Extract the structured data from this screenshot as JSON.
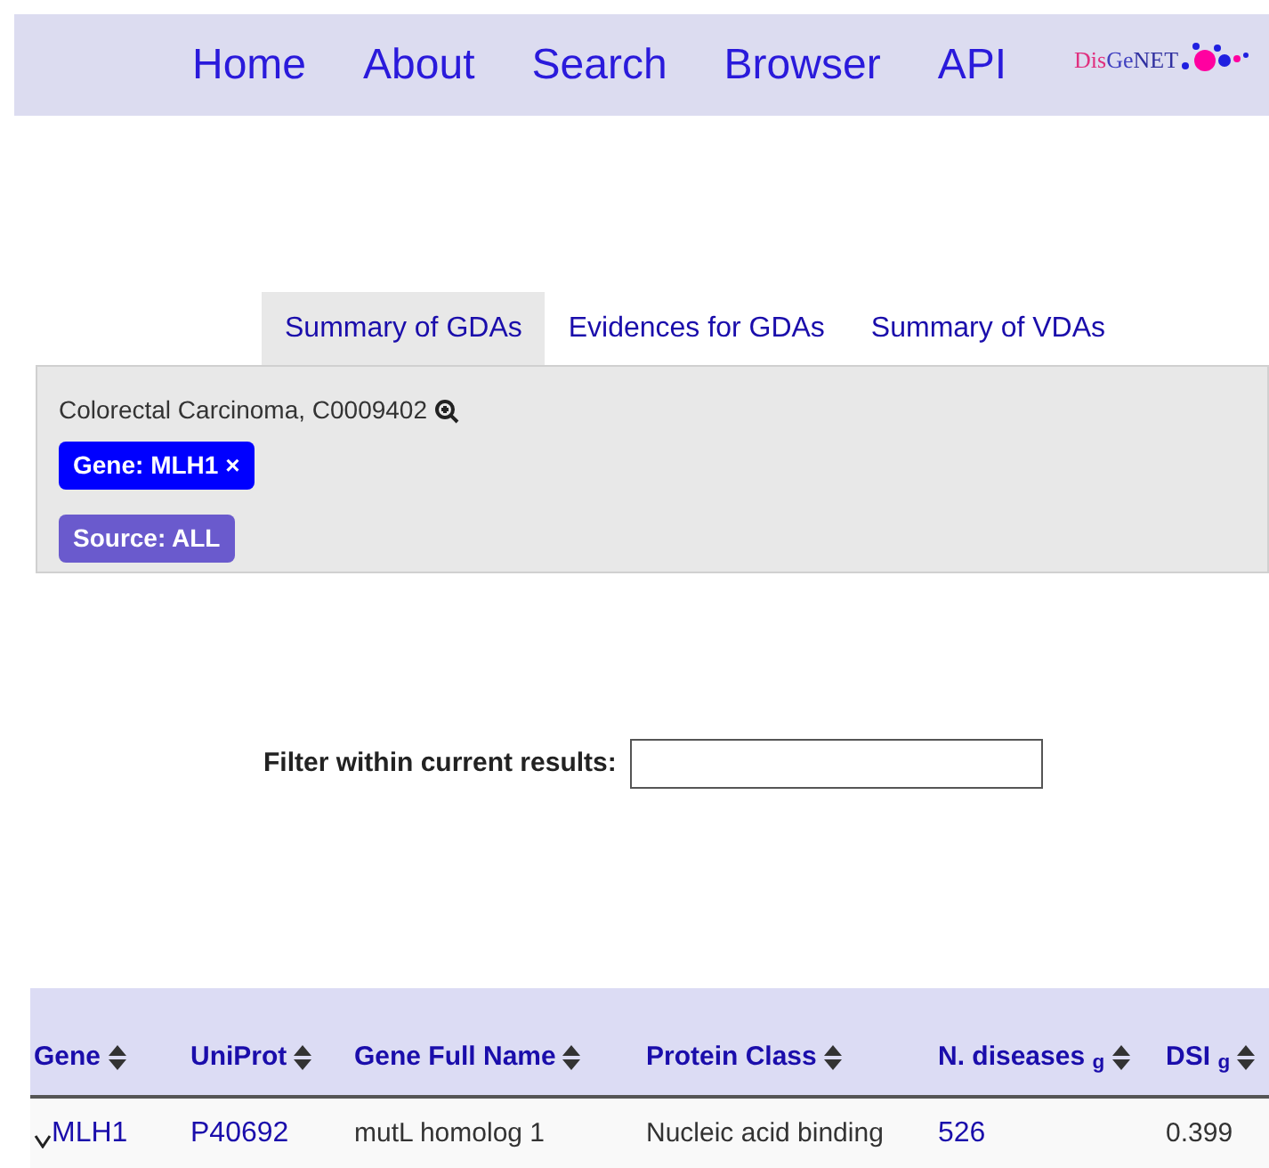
{
  "nav": {
    "links": [
      "Home",
      "About",
      "Search",
      "Browser",
      "API"
    ],
    "logo": {
      "part_1": "Dis",
      "part_2": "Ge",
      "part_3": "NET"
    }
  },
  "tabs": [
    {
      "label": "Summary of GDAs",
      "selected": true
    },
    {
      "label": "Evidences for GDAs",
      "selected": false
    },
    {
      "label": "Summary of VDAs",
      "selected": false
    }
  ],
  "panel": {
    "disease": "Colorectal Carcinoma, C0009402",
    "filters": [
      {
        "kind": "removable",
        "label": "Gene: MLH1",
        "remove": "×"
      },
      {
        "kind": "fixed",
        "label": "Source: ALL"
      }
    ]
  },
  "filter": {
    "label": "Filter within current results:"
  },
  "table": {
    "columns": [
      "Gene",
      "UniProt",
      "Gene Full Name",
      "Protein Class",
      "N. diseases $_{g}$",
      "DSI $_{g}$"
    ],
    "rows": [
      {
        "expanded": false,
        "cells": [
          {
            "kind": "link",
            "text": "MLH1"
          },
          {
            "kind": "link",
            "text": "P40692"
          },
          {
            "kind": "text",
            "text": "mutL homolog 1"
          },
          {
            "kind": "text",
            "text": "Nucleic acid binding"
          },
          {
            "kind": "link",
            "text": "526"
          },
          {
            "kind": "text",
            "text": "0.399"
          }
        ]
      }
    ]
  }
}
